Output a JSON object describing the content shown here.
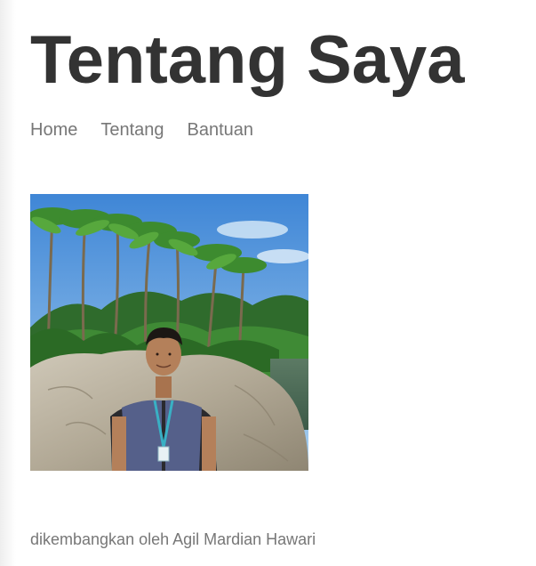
{
  "page": {
    "title": "Tentang Saya"
  },
  "nav": {
    "items": [
      {
        "label": "Home"
      },
      {
        "label": "Tentang"
      },
      {
        "label": "Bantuan"
      }
    ]
  },
  "profile_photo": {
    "subject": "portrait"
  },
  "footer": {
    "text": "dikembangkan oleh Agil Mardian Hawari"
  },
  "colors": {
    "title": "#333333",
    "nav_link": "#777777",
    "footer_text": "#777777",
    "background": "#ffffff"
  }
}
